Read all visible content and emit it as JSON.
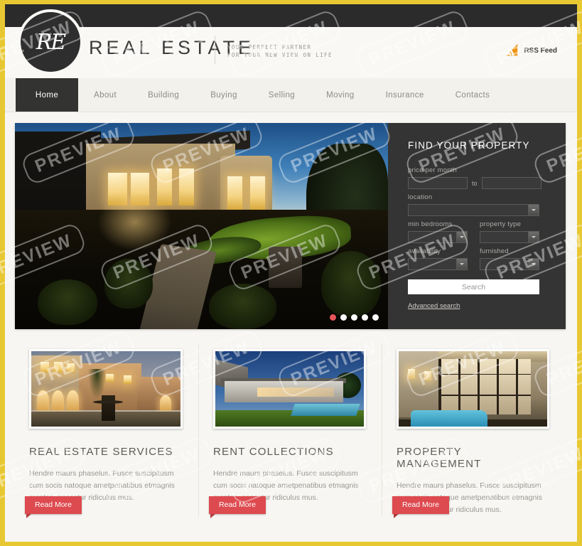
{
  "site": {
    "brand": "REAL ESTATE",
    "logo_monogram": "RE",
    "tagline_line1": "YOUR PERFECT PARTNER",
    "tagline_line2": "FOR YOUR NEW VIEW ON LIFE",
    "rss_label": "RSS Feed",
    "watermark_text": "PREVIEW",
    "colors": {
      "page_border": "#e8c832",
      "header_dark": "#2b2b2b",
      "nav_active": "#333331",
      "panel_bg": "#343434",
      "accent_red": "#dd4a4f",
      "dot_active": "#e8565a"
    }
  },
  "nav": {
    "items": [
      {
        "label": "Home",
        "active": true
      },
      {
        "label": "About",
        "active": false
      },
      {
        "label": "Building",
        "active": false
      },
      {
        "label": "Buying",
        "active": false
      },
      {
        "label": "Selling",
        "active": false
      },
      {
        "label": "Moving",
        "active": false
      },
      {
        "label": "Insurance",
        "active": false
      },
      {
        "label": "Contacts",
        "active": false
      }
    ]
  },
  "hero": {
    "image_alt": "Illuminated modern home at dusk with landscaped garden path",
    "slides_count": 5,
    "active_slide": 1
  },
  "search": {
    "title": "FIND YOUR PROPERTY",
    "price_label": "price per month",
    "price_min": "",
    "price_max": "",
    "price_separator": "to",
    "location_label": "location",
    "location_value": "",
    "bedrooms_label": "min bedrooms",
    "bedrooms_value": "",
    "property_type_label": "property type",
    "property_type_value": "",
    "availability_label": "availability",
    "availability_value": "",
    "furnished_label": "furnished",
    "furnished_value": "",
    "search_button": "Search",
    "advanced_link": "Advanced search"
  },
  "cards": [
    {
      "title": "REAL ESTATE SERVICES",
      "text": "Hendre maurs phaselus. Fusce suscipitusm cum socis natoque ametpenatibus etmagnis montes, nascetur ridiculus mus.",
      "button": "Read More",
      "image_alt": "Mediterranean villa with arched entry and fountain at dusk"
    },
    {
      "title": "RENT COLLECTIONS",
      "text": "Hendre maurs phaselus. Fusce suscipitusm cum socis natoque ametpenatibus etmagnis montes, nascetur ridiculus mus.",
      "button": "Read More",
      "image_alt": "Modern single storey house with swimming pool and lawn"
    },
    {
      "title": "PROPERTY MANAGEMENT",
      "text": "Hendre maurs phaselus. Fusce suscipitusm cum socis natoque ametpenatibus etmagnis montes, nascetur ridiculus mus.",
      "button": "Read More",
      "image_alt": "Interior patio with glass doors, stone wall sconces and pool"
    }
  ]
}
